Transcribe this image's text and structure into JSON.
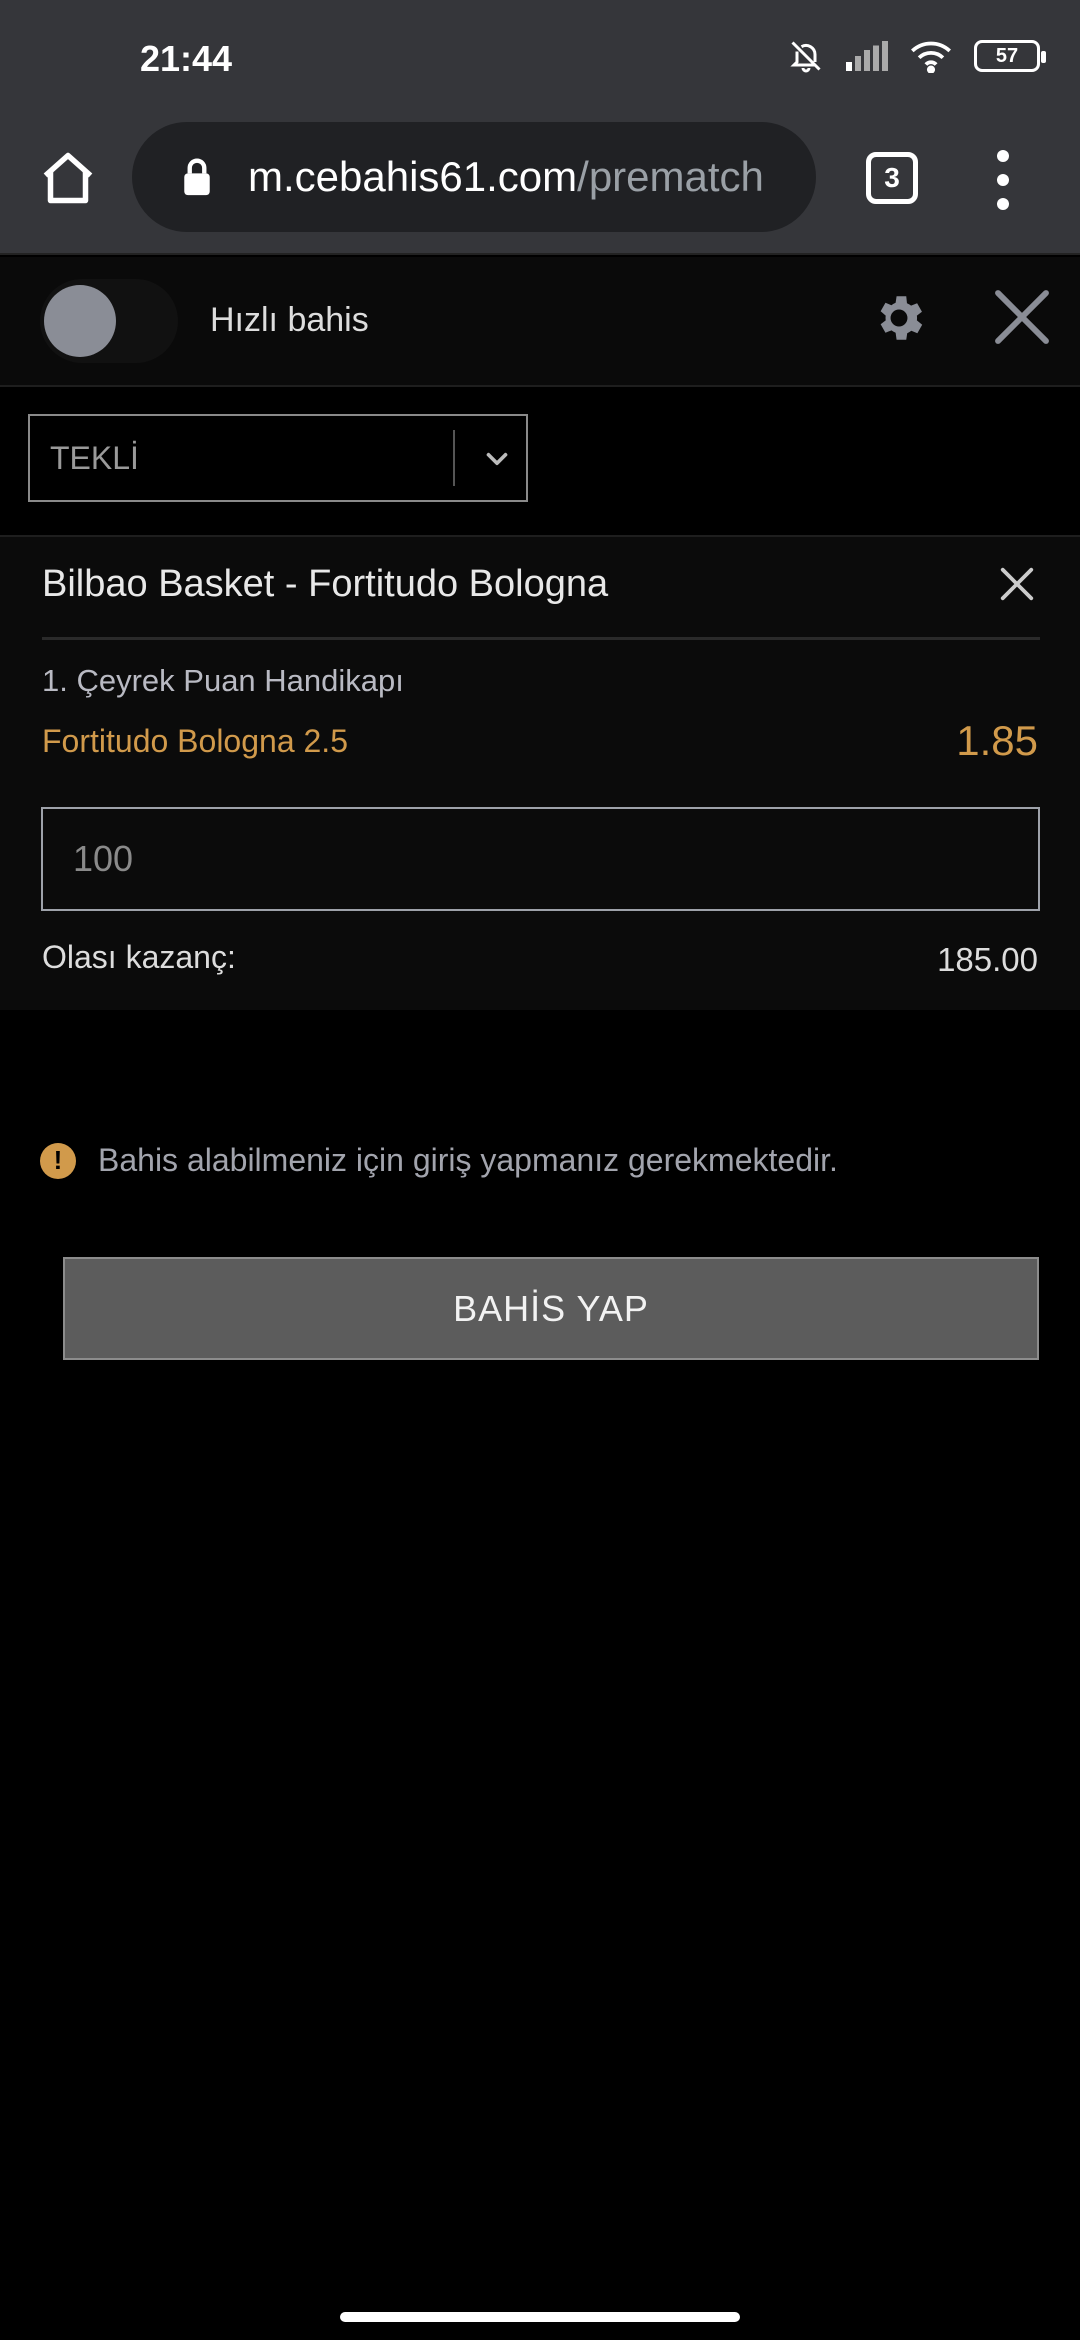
{
  "status_bar": {
    "time": "21:44",
    "battery": "57",
    "icons": [
      "bell-off-icon",
      "signal-icon",
      "wifi-icon",
      "battery-icon"
    ]
  },
  "browser": {
    "url_host": "m.cebahis61.com",
    "url_path": "/prematch",
    "tab_count": "3"
  },
  "header": {
    "quick_bet_label": "Hızlı bahis",
    "quick_bet_enabled": false
  },
  "bet_type": {
    "selected": "TEKLİ"
  },
  "bet": {
    "match": "Bilbao Basket - Fortitudo Bologna",
    "market": "1. Çeyrek Puan Handikapı",
    "selection": "Fortitudo Bologna 2.5",
    "odds": "1.85",
    "stake_placeholder": "100",
    "potential_win_label": "Olası kazanç:",
    "potential_win_value": "185.00"
  },
  "warning": {
    "icon": "!",
    "text": "Bahis alabilmeniz için giriş yapmanız gerekmektedir."
  },
  "actions": {
    "place_bet_label": "BAHİS YAP"
  },
  "colors": {
    "accent": "#d19a4b",
    "background": "#000000",
    "card": "#0b0b0b",
    "button": "#5c5c5c"
  }
}
